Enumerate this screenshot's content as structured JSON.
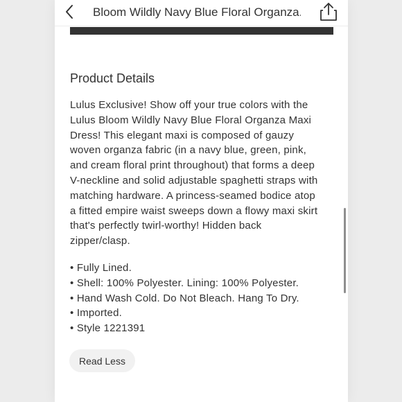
{
  "header": {
    "title": "Bloom Wildly Navy Blue Floral Organza..."
  },
  "product_details": {
    "heading": "Product Details",
    "description": "Lulus Exclusive! Show off your true colors with the Lulus Bloom Wildly Navy Blue Floral Organza Maxi Dress! This elegant maxi is composed of gauzy woven organza fabric (in a navy blue, green, pink, and cream floral print throughout) that forms a deep V-neckline and solid adjustable spaghetti straps with matching hardware. A princess-seamed bodice atop a fitted empire waist sweeps down a flowy maxi skirt that's perfectly twirl-worthy! Hidden back zipper/clasp.",
    "bullets": [
      "Fully Lined.",
      "Shell: 100% Polyester. Lining: 100% Polyester.",
      "Hand Wash Cold. Do Not Bleach. Hang To Dry.",
      "Imported.",
      "Style 1221391"
    ],
    "read_less_label": "Read Less"
  },
  "icons": {
    "back": "chevron-left-icon",
    "share": "share-icon"
  }
}
